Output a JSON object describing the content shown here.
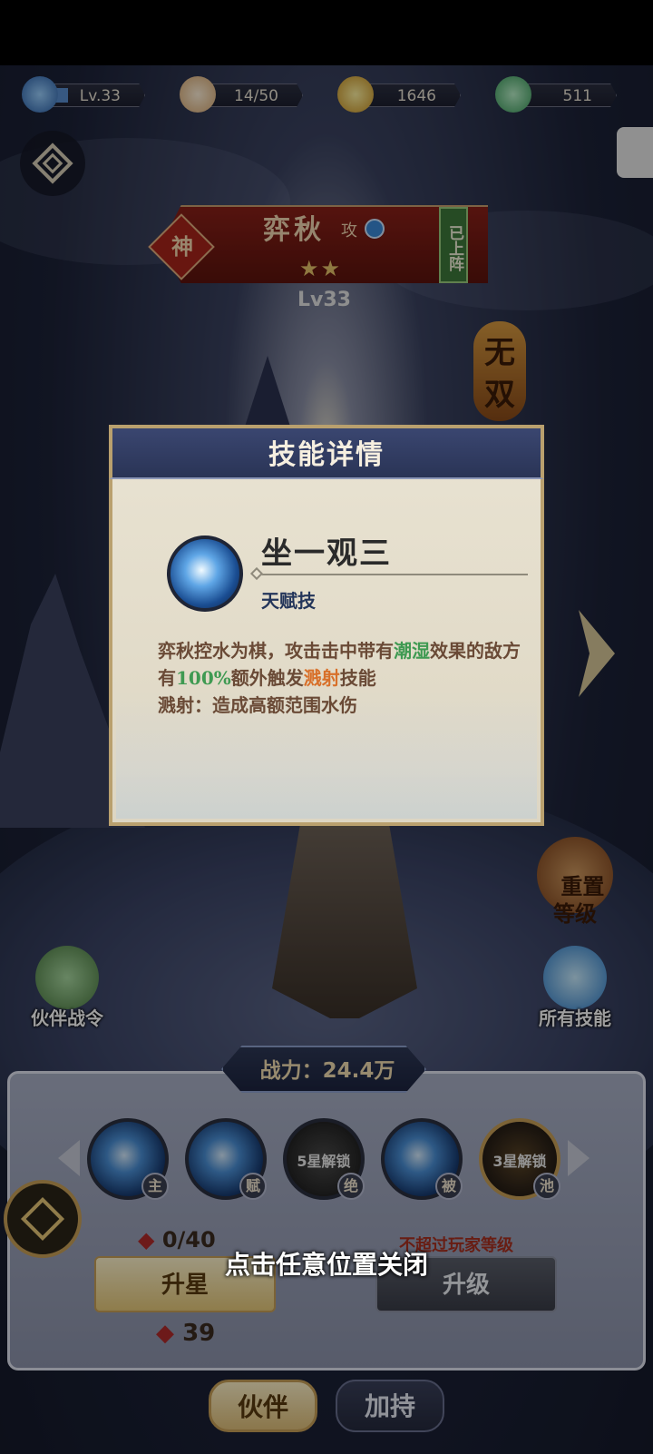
{
  "resources": {
    "level": "Lv.33",
    "stamina": "14/50",
    "coins": "1646",
    "jade": "511"
  },
  "hero": {
    "rank": "神",
    "name": "弈秋",
    "role": "攻",
    "stars": "★★",
    "deployed": "已上阵",
    "level": "Lv33"
  },
  "side": {
    "wushuang": "无双",
    "reset_level": "重置\n等级",
    "all_skills": "所有技能",
    "partner_pass": "伙伴战令"
  },
  "modal": {
    "title": "技能详情",
    "skill_name": "坐一观三",
    "skill_type": "天赋技",
    "desc": {
      "p1": "弈秋控水为棋，攻击击中带有",
      "k1": "潮湿",
      "p2": "效果的敌方有",
      "k2": "100%",
      "p3": "额外触发",
      "k3": "溅射",
      "p4": "技能",
      "p5": "溅射：造成高额范围水伤"
    }
  },
  "power": "战力：24.4万",
  "skills": [
    {
      "tag": "主"
    },
    {
      "tag": "赋"
    },
    {
      "tag": "绝",
      "lock": "5星解锁"
    },
    {
      "tag": "被"
    },
    {
      "tag": "池",
      "lock": "3星解锁"
    }
  ],
  "upgrade": {
    "shards": "0/40",
    "star_button": "升星",
    "level_note": "不超过玩家等级",
    "level_button": "升级",
    "cost": "39"
  },
  "close_hint": "点击任意位置关闭",
  "nav": {
    "partner": "伙伴",
    "boost": "加持"
  }
}
